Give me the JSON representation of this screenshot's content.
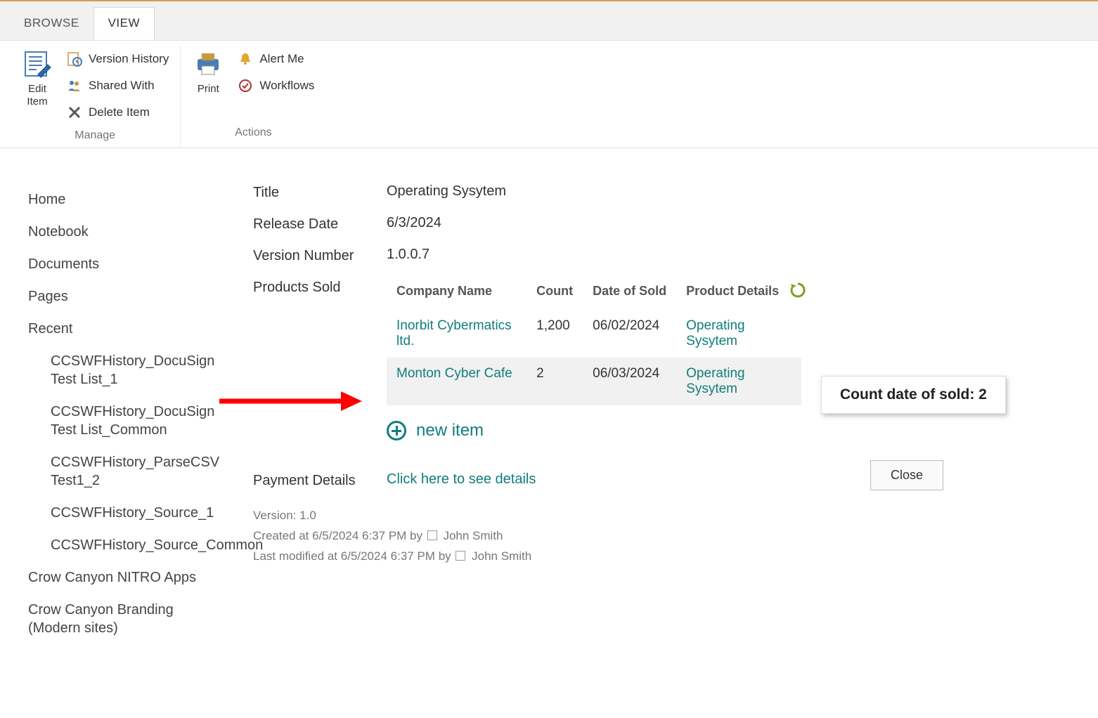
{
  "tabs": {
    "browse": "BROWSE",
    "view": "VIEW"
  },
  "ribbon": {
    "manage": {
      "edit_item": "Edit\nItem",
      "version_history": "Version History",
      "shared_with": "Shared With",
      "delete_item": "Delete Item",
      "group_label": "Manage"
    },
    "actions": {
      "print": "Print",
      "alert_me": "Alert Me",
      "workflows": "Workflows",
      "group_label": "Actions"
    }
  },
  "nav": {
    "home": "Home",
    "notebook": "Notebook",
    "documents": "Documents",
    "pages": "Pages",
    "recent": "Recent",
    "recent_items": [
      "CCSWFHistory_DocuSign Test List_1",
      "CCSWFHistory_DocuSign Test List_Common",
      "CCSWFHistory_ParseCSV Test1_2",
      "CCSWFHistory_Source_1",
      "CCSWFHistory_Source_Common"
    ],
    "nitro_apps": "Crow Canyon NITRO Apps",
    "branding": "Crow Canyon Branding (Modern sites)"
  },
  "fields": {
    "title_label": "Title",
    "title_value": "Operating Sysytem",
    "release_date_label": "Release Date",
    "release_date_value": "6/3/2024",
    "version_number_label": "Version Number",
    "version_number_value": "1.0.0.7",
    "products_sold_label": "Products Sold",
    "payment_details_label": "Payment Details",
    "payment_details_link": "Click here to see details"
  },
  "products_table": {
    "headers": {
      "company": "Company Name",
      "count": "Count",
      "date": "Date of Sold",
      "details": "Product Details"
    },
    "rows": [
      {
        "company": "Inorbit Cybermatics ltd.",
        "count": "1,200",
        "date": "06/02/2024",
        "details": "Operating Sysytem"
      },
      {
        "company": "Monton Cyber Cafe",
        "count": "2",
        "date": "06/03/2024",
        "details": "Operating Sysytem"
      }
    ]
  },
  "new_item_label": "new item",
  "count_box": "Count date of sold: 2",
  "meta": {
    "version": "Version: 1.0",
    "created_prefix": "Created at ",
    "created_datetime": "6/5/2024 6:37 PM",
    "by": "  by ",
    "created_user": "John Smith",
    "modified_prefix": "Last modified at ",
    "modified_datetime": "6/5/2024 6:37 PM",
    "modified_user": "John Smith"
  },
  "close_label": "Close"
}
